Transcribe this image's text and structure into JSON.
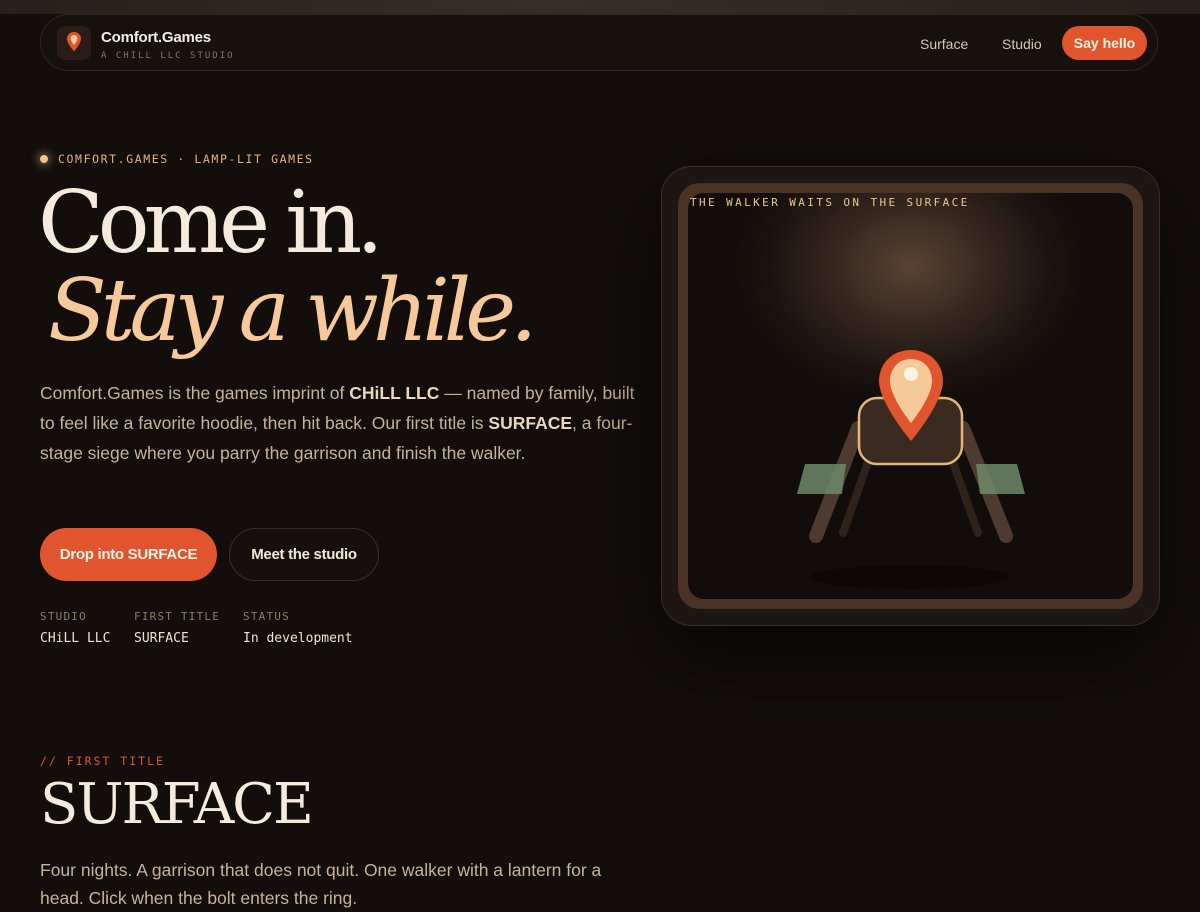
{
  "nav": {
    "brand_name": "Comfort.Games",
    "brand_sub": "A CHILL LLC STUDIO",
    "logo_icon": "map-pin-icon",
    "links": [
      "Surface",
      "Studio"
    ],
    "cta": "Say hello"
  },
  "hero": {
    "eyebrow": "COMFORT.GAMES · LAMP-LIT GAMES",
    "title_line1": "Come in.",
    "title_line2": "Stay a while.",
    "lead_parts": {
      "a": "Comfort.Games is the games imprint of ",
      "b": "CHiLL LLC",
      "c": " — named by family, built to feel like a favorite hoodie, then hit back. Our first title is ",
      "d": "SURFACE",
      "e": ", a four-stage siege where you parry the garrison and finish the walker."
    },
    "primary_button": "Drop into SURFACE",
    "secondary_button": "Meet the studio",
    "meta": [
      {
        "label": "STUDIO",
        "value": "CHiLL LLC"
      },
      {
        "label": "FIRST TITLE",
        "value": "SURFACE"
      },
      {
        "label": "STATUS",
        "value": "In development"
      }
    ]
  },
  "art": {
    "caption": "THE WALKER WAITS ON THE SURFACE",
    "icon": "walker-with-pin-icon"
  },
  "section": {
    "eyebrow": "// FIRST TITLE",
    "title": "SURFACE",
    "body": "Four nights. A garrison that does not quit. One walker with a lantern for a head. Click when the bolt enters the ring."
  },
  "colors": {
    "background": "#130e0b",
    "accent": "#e0552e",
    "cream": "#f5eadb",
    "peach": "#f6c99a"
  }
}
